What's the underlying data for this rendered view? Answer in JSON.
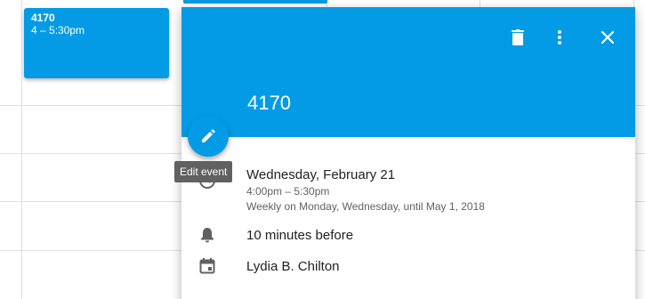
{
  "calendar_event": {
    "title": "4170",
    "time": "4 – 5:30pm",
    "color": "#039be5"
  },
  "detail_card": {
    "header_color": "#039be5",
    "title": "4170",
    "actions": {
      "delete_icon": "trash-icon",
      "more_icon": "more-vert-icon",
      "close_icon": "close-icon"
    },
    "edit_fab_icon": "pencil-icon",
    "edit_tooltip": "Edit event",
    "date": "Wednesday, February 21",
    "time": "4:00pm – 5:30pm",
    "recurrence": "Weekly on Monday, Wednesday, until May 1, 2018",
    "reminder": "10 minutes before",
    "reminder_icon": "bell-icon",
    "calendar_owner": "Lydia B. Chilton",
    "calendar_icon": "calendar-icon",
    "time_icon": "clock-icon"
  }
}
